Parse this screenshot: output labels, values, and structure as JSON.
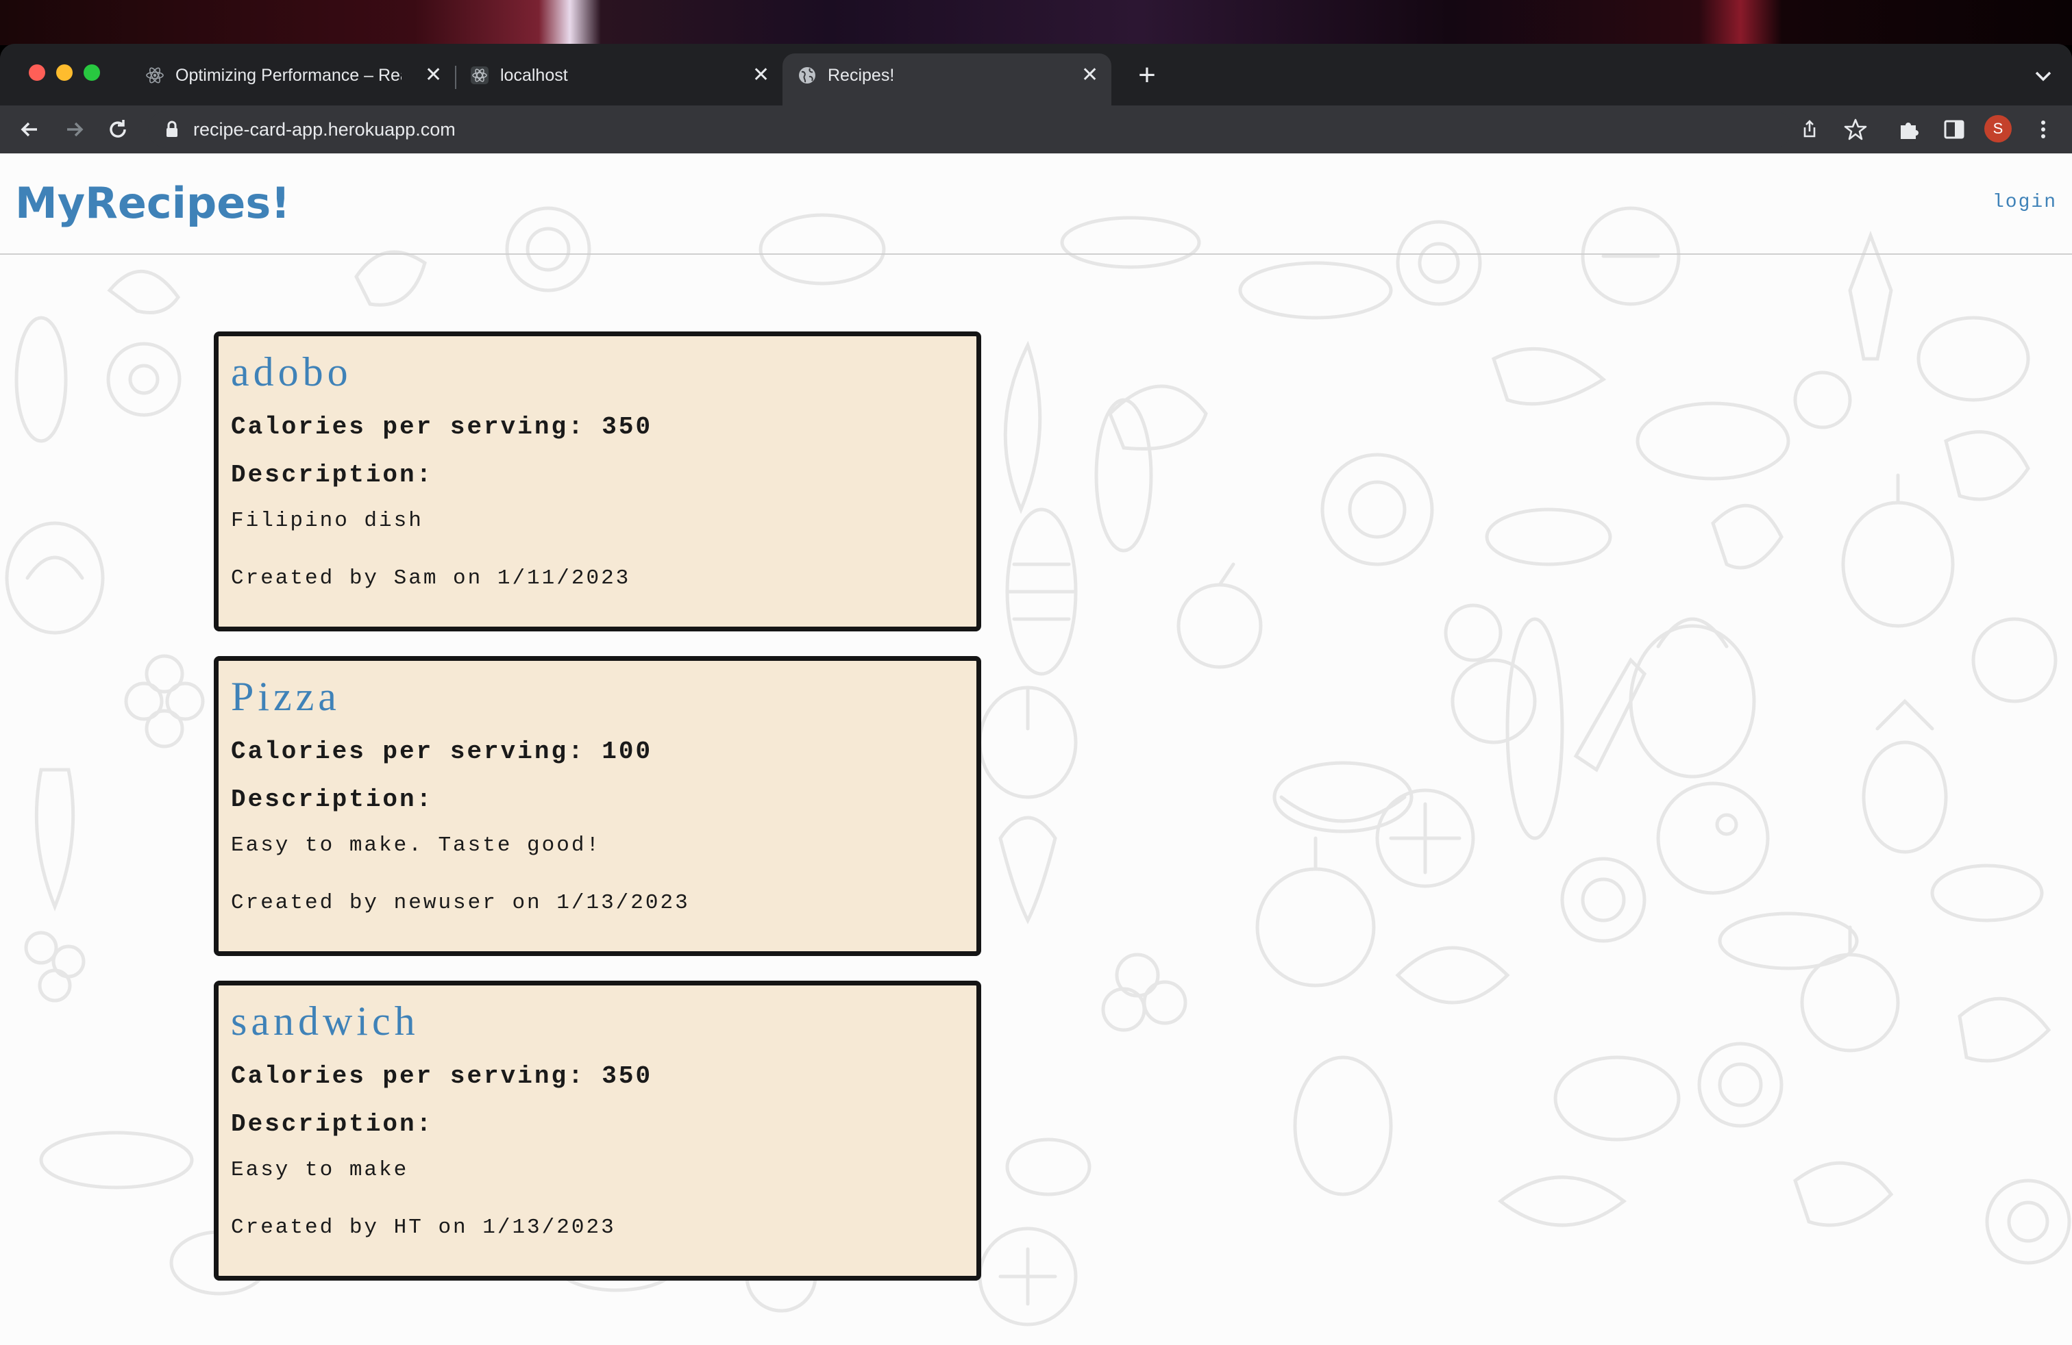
{
  "browser": {
    "tabs": [
      {
        "title": "Optimizing Performance – React",
        "favicon": "react-icon",
        "active": false
      },
      {
        "title": "localhost",
        "favicon": "react-icon",
        "active": false
      },
      {
        "title": "Recipes!",
        "favicon": "globe-icon",
        "active": true
      }
    ],
    "new_tab_label": "+",
    "url": "recipe-card-app.herokuapp.com",
    "profile_initial": "S",
    "colors": {
      "chrome": "#202124",
      "toolbar": "#35363a",
      "avatar": "#c4412b"
    }
  },
  "site": {
    "brand": "MyRecipes!",
    "login": "login",
    "colors": {
      "accent": "#3f82b8",
      "card_bg": "#f6e9d5",
      "card_border": "#151515"
    }
  },
  "recipes": [
    {
      "name": "adobo",
      "calories": "Calories per serving: 350",
      "description_label": "Description:",
      "description": "Filipino dish",
      "created": "Created by Sam on 1/11/2023"
    },
    {
      "name": "Pizza",
      "calories": "Calories per serving: 100",
      "description_label": "Description:",
      "description": "Easy to make. Taste good!",
      "created": "Created by newuser on 1/13/2023"
    },
    {
      "name": "sandwich",
      "calories": "Calories per serving: 350",
      "description_label": "Description:",
      "description": "Easy to make",
      "created": "Created by HT on 1/13/2023"
    }
  ]
}
